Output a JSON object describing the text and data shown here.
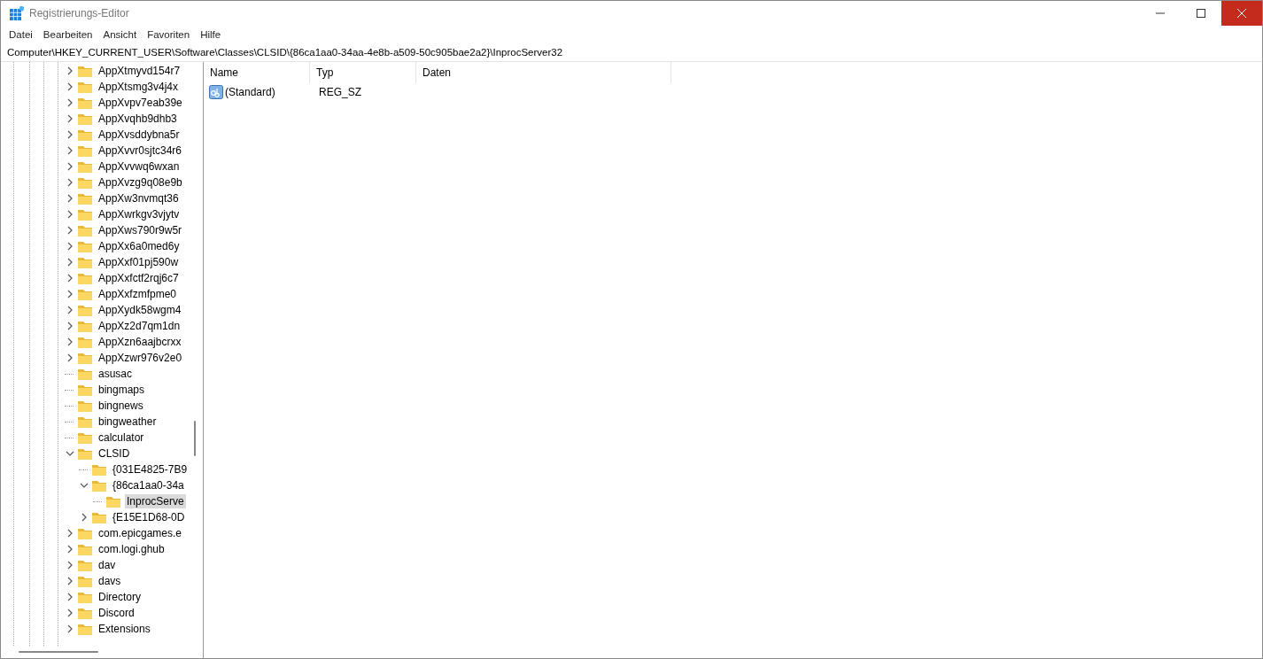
{
  "window": {
    "title": "Registrierungs-Editor"
  },
  "menu": [
    "Datei",
    "Bearbeiten",
    "Ansicht",
    "Favoriten",
    "Hilfe"
  ],
  "address": "Computer\\HKEY_CURRENT_USER\\Software\\Classes\\CLSID\\{86ca1aa0-34aa-4e8b-a509-50c905bae2a2}\\InprocServer32",
  "tree": [
    {
      "label": "AppXtmyvd154r7",
      "has_children": true,
      "expanded": false,
      "selected": false
    },
    {
      "label": "AppXtsmg3v4j4x",
      "has_children": true,
      "expanded": false,
      "selected": false
    },
    {
      "label": "AppXvpv7eab39e",
      "has_children": true,
      "expanded": false,
      "selected": false
    },
    {
      "label": "AppXvqhb9dhb3",
      "has_children": true,
      "expanded": false,
      "selected": false
    },
    {
      "label": "AppXvsddybna5r",
      "has_children": true,
      "expanded": false,
      "selected": false
    },
    {
      "label": "AppXvvr0sjtc34r6",
      "has_children": true,
      "expanded": false,
      "selected": false
    },
    {
      "label": "AppXvvwq6wxan",
      "has_children": true,
      "expanded": false,
      "selected": false
    },
    {
      "label": "AppXvzg9q08e9b",
      "has_children": true,
      "expanded": false,
      "selected": false
    },
    {
      "label": "AppXw3nvmqt36",
      "has_children": true,
      "expanded": false,
      "selected": false
    },
    {
      "label": "AppXwrkgv3vjytv",
      "has_children": true,
      "expanded": false,
      "selected": false
    },
    {
      "label": "AppXws790r9w5r",
      "has_children": true,
      "expanded": false,
      "selected": false
    },
    {
      "label": "AppXx6a0med6y",
      "has_children": true,
      "expanded": false,
      "selected": false
    },
    {
      "label": "AppXxf01pj590w",
      "has_children": true,
      "expanded": false,
      "selected": false
    },
    {
      "label": "AppXxfctf2rqj6c7",
      "has_children": true,
      "expanded": false,
      "selected": false
    },
    {
      "label": "AppXxfzmfpme0",
      "has_children": true,
      "expanded": false,
      "selected": false
    },
    {
      "label": "AppXydk58wgm4",
      "has_children": true,
      "expanded": false,
      "selected": false
    },
    {
      "label": "AppXz2d7qm1dn",
      "has_children": true,
      "expanded": false,
      "selected": false
    },
    {
      "label": "AppXzn6aajbcrxx",
      "has_children": true,
      "expanded": false,
      "selected": false
    },
    {
      "label": "AppXzwr976v2e0",
      "has_children": true,
      "expanded": false,
      "selected": false
    },
    {
      "label": "asusac",
      "has_children": false,
      "selected": false
    },
    {
      "label": "bingmaps",
      "has_children": false,
      "selected": false
    },
    {
      "label": "bingnews",
      "has_children": false,
      "selected": false
    },
    {
      "label": "bingweather",
      "has_children": false,
      "selected": false
    },
    {
      "label": "calculator",
      "has_children": false,
      "selected": false
    },
    {
      "label": "CLSID",
      "has_children": true,
      "expanded": true,
      "selected": false,
      "children": [
        {
          "label": "{031E4825-7B9",
          "has_children": false,
          "selected": false
        },
        {
          "label": "{86ca1aa0-34a",
          "has_children": true,
          "expanded": true,
          "selected": false,
          "children": [
            {
              "label": "InprocServe",
              "has_children": false,
              "selected": true
            }
          ]
        },
        {
          "label": "{E15E1D68-0D",
          "has_children": true,
          "expanded": false,
          "selected": false
        }
      ]
    },
    {
      "label": "com.epicgames.e",
      "has_children": true,
      "expanded": false,
      "selected": false
    },
    {
      "label": "com.logi.ghub",
      "has_children": true,
      "expanded": false,
      "selected": false
    },
    {
      "label": "dav",
      "has_children": true,
      "expanded": false,
      "selected": false
    },
    {
      "label": "davs",
      "has_children": true,
      "expanded": false,
      "selected": false
    },
    {
      "label": "Directory",
      "has_children": true,
      "expanded": false,
      "selected": false
    },
    {
      "label": "Discord",
      "has_children": true,
      "expanded": false,
      "selected": false
    },
    {
      "label": "Extensions",
      "has_children": true,
      "expanded": false,
      "selected": false
    }
  ],
  "list": {
    "columns": [
      "Name",
      "Typ",
      "Daten"
    ],
    "rows": [
      {
        "name": "(Standard)",
        "type": "REG_SZ",
        "data": ""
      }
    ]
  }
}
